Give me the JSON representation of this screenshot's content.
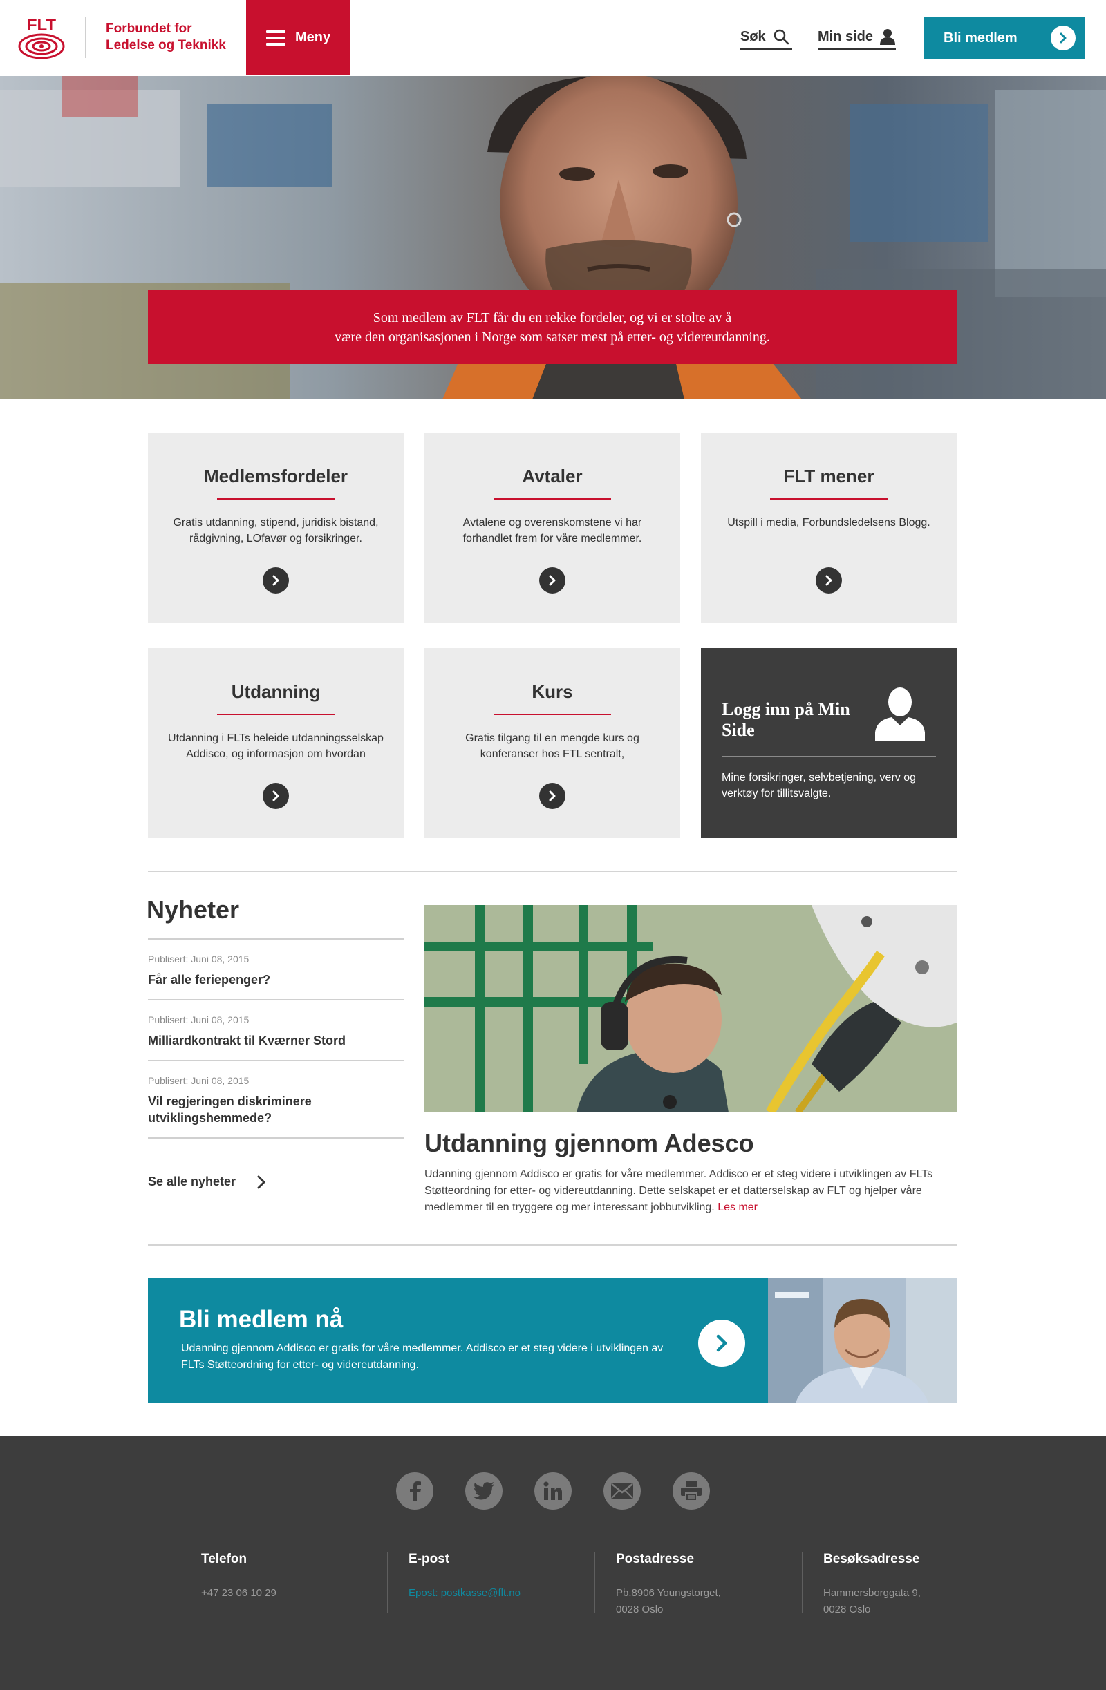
{
  "header": {
    "logo_text": "FLT",
    "org_name_line1": "Forbundet for",
    "org_name_line2": "Ledelse og Teknikk",
    "menu_label": "Meny",
    "search_label": "Søk",
    "my_page_label": "Min side",
    "join_label": "Bli medlem"
  },
  "hero": {
    "line1": "Som medlem av FLT får du en rekke fordeler, og vi er stolte av å",
    "line2": "være den organisasjonen i Norge som satser mest på etter- og videreutdanning."
  },
  "cards": [
    {
      "title": "Medlemsfordeler",
      "text": "Gratis utdanning, stipend, juridisk bistand, rådgivning, LOfavør og forsikringer."
    },
    {
      "title": "Avtaler",
      "text": "Avtalene og overenskomstene vi har forhandlet frem for våre medlemmer."
    },
    {
      "title": "FLT mener",
      "text": "Utspill i media, Forbundsledelsens Blogg."
    },
    {
      "title": "Utdanning",
      "text": "Utdanning i FLTs heleide utdanningsselskap Addisco, og informasjon om hvordan"
    },
    {
      "title": "Kurs",
      "text": "Gratis tilgang til en mengde kurs og konferanser hos FTL sentralt,"
    }
  ],
  "login_card": {
    "title": "Logg inn på Min Side",
    "text": "Mine forsikringer, selvbetjening, verv og verktøy for tillitsvalgte."
  },
  "news": {
    "title": "Nyheter",
    "items": [
      {
        "date": "Publisert: Juni 08, 2015",
        "headline": "Får alle feriepenger?"
      },
      {
        "date": "Publisert: Juni 08, 2015",
        "headline": "Milliardkontrakt til Kværner Stord"
      },
      {
        "date": "Publisert: Juni 08, 2015",
        "headline": "Vil regjeringen diskriminere utviklingshemmede?"
      }
    ],
    "see_all": "Se alle nyheter"
  },
  "feature": {
    "title": "Utdanning gjennom Adesco",
    "text": "Udanning gjennom Addisco er gratis for våre medlemmer. Addisco er et steg videre i utviklingen av FLTs Støtteordning for etter- og videreutdanning. Dette selskapet er et datterselskap av FLT og hjelper våre medlemmer til en tryggere og mer interessant jobbutvikling.",
    "more": "Les mer"
  },
  "cta": {
    "title": "Bli medlem nå",
    "text": "Udanning gjennom Addisco er gratis for våre medlemmer. Addisco er et steg videre i utviklingen av FLTs Støtteordning for etter- og videreutdanning."
  },
  "footer": {
    "social": [
      "facebook-icon",
      "twitter-icon",
      "linkedin-icon",
      "mail-icon",
      "print-icon"
    ],
    "phone_label": "Telefon",
    "phone": "+47 23 06 10 29",
    "email_label": "E-post",
    "email": "Epost: postkasse@flt.no",
    "postal_label": "Postadresse",
    "postal_line1": "Pb.8906 Youngstorget,",
    "postal_line2": "0028 Oslo",
    "visit_label": "Besøksadresse",
    "visit_line1": "Hammersborggata 9,",
    "visit_line2": "0028 Oslo"
  },
  "colors": {
    "brand_red": "#c8102e",
    "teal": "#0e8aa0",
    "dark": "#3d3d3d",
    "card_bg": "#ececec"
  }
}
